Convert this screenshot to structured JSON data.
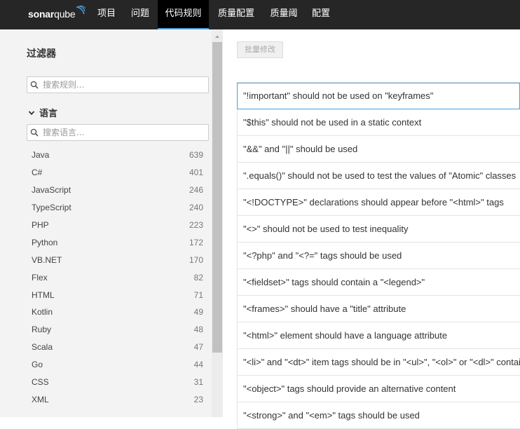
{
  "nav": {
    "logo": {
      "sonar": "sonar",
      "qube": "qube"
    },
    "items": [
      {
        "label": "项目"
      },
      {
        "label": "问题"
      },
      {
        "label": "代码规则"
      },
      {
        "label": "质量配置"
      },
      {
        "label": "质量阈"
      },
      {
        "label": "配置"
      }
    ],
    "active": "代码规则",
    "accent_color": "#4b9fd5"
  },
  "sidebar": {
    "title": "过滤器",
    "search_placeholder": "搜索规则...",
    "language_facet": {
      "title": "语言",
      "search_placeholder": "搜索语言...",
      "items": [
        {
          "name": "Java",
          "count": "639"
        },
        {
          "name": "C#",
          "count": "401"
        },
        {
          "name": "JavaScript",
          "count": "246"
        },
        {
          "name": "TypeScript",
          "count": "240"
        },
        {
          "name": "PHP",
          "count": "223"
        },
        {
          "name": "Python",
          "count": "172"
        },
        {
          "name": "VB.NET",
          "count": "170"
        },
        {
          "name": "Flex",
          "count": "82"
        },
        {
          "name": "HTML",
          "count": "71"
        },
        {
          "name": "Kotlin",
          "count": "49"
        },
        {
          "name": "Ruby",
          "count": "48"
        },
        {
          "name": "Scala",
          "count": "47"
        },
        {
          "name": "Go",
          "count": "44"
        },
        {
          "name": "CSS",
          "count": "31"
        },
        {
          "name": "XML",
          "count": "23"
        }
      ]
    }
  },
  "main": {
    "bulk_change_label": "批量修改",
    "rules": [
      "\"!important\" should not be used on \"keyframes\"",
      "\"$this\" should not be used in a static context",
      "\"&&\" and \"||\" should be used",
      "\".equals()\" should not be used to test the values of \"Atomic\" classes",
      "\"<!DOCTYPE>\" declarations should appear before \"<html>\" tags",
      "\"<>\" should not be used to test inequality",
      "\"<?php\" and \"<?=\" tags should be used",
      "\"<fieldset>\" tags should contain a \"<legend>\"",
      "\"<frames>\" should have a \"title\" attribute",
      "\"<html>\" element should have a language attribute",
      "\"<li>\" and \"<dt>\" item tags should be in \"<ul>\", \"<ol>\" or \"<dl>\" contai",
      "\"<object>\" tags should provide an alternative content",
      "\"<strong>\" and \"<em>\" tags should be used"
    ]
  }
}
